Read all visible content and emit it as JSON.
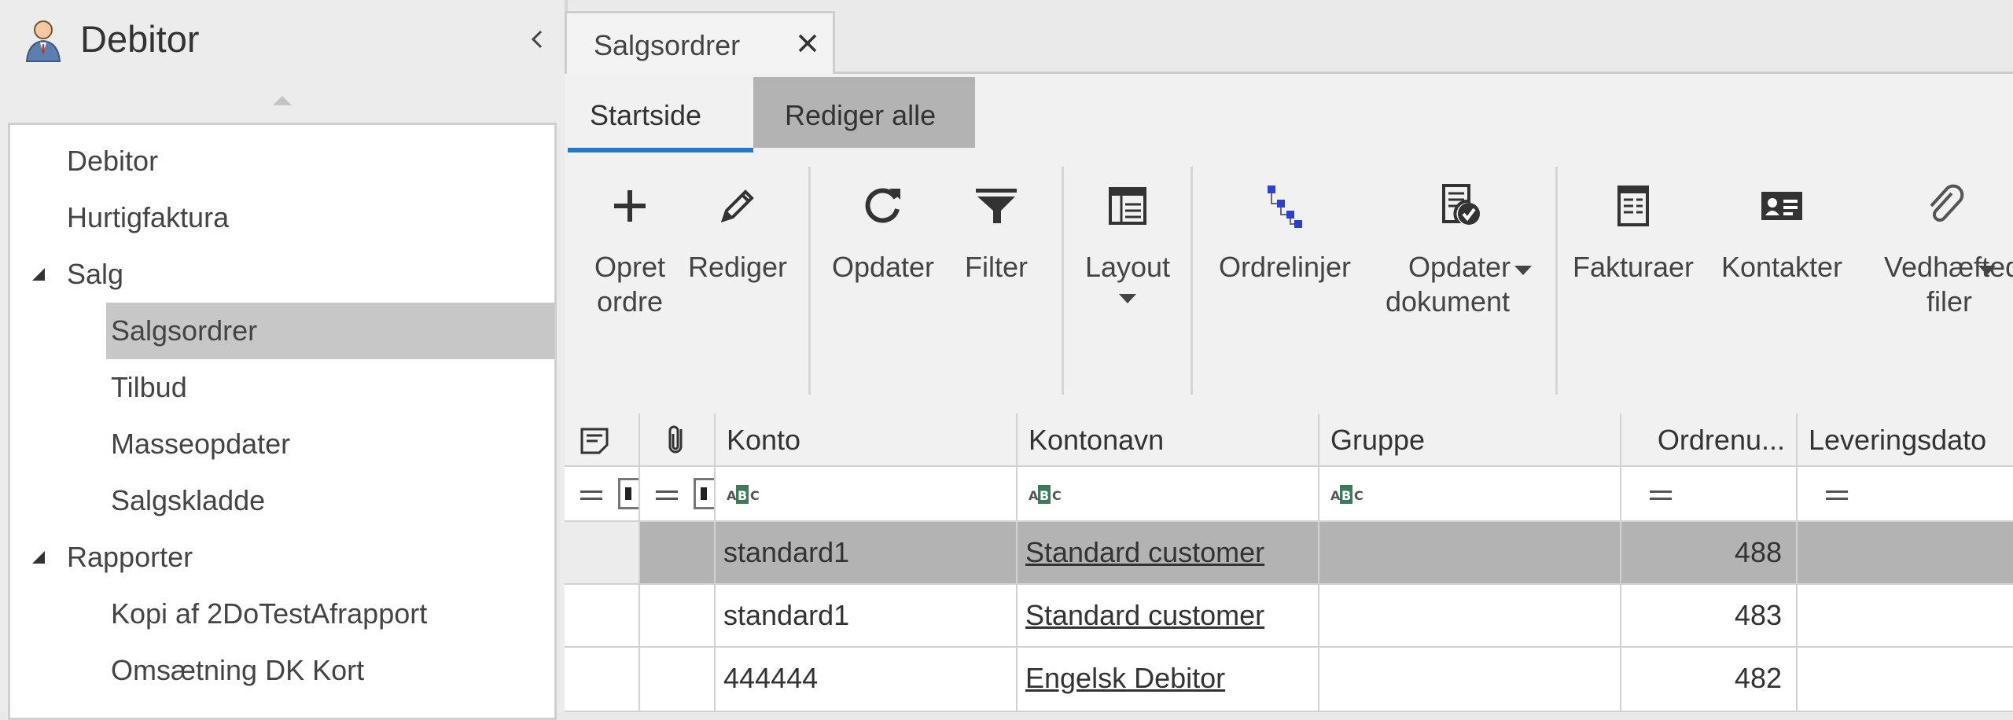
{
  "navigation": {
    "title": "Debitor",
    "items": [
      {
        "label": "Debitor",
        "level": 1,
        "expandable": false,
        "selected": false
      },
      {
        "label": "Hurtigfaktura",
        "level": 1,
        "expandable": false,
        "selected": false
      },
      {
        "label": "Salg",
        "level": 1,
        "expandable": true,
        "selected": false
      },
      {
        "label": "Salgsordrer",
        "level": 2,
        "expandable": false,
        "selected": true
      },
      {
        "label": "Tilbud",
        "level": 2,
        "expandable": false,
        "selected": false
      },
      {
        "label": "Masseopdater",
        "level": 2,
        "expandable": false,
        "selected": false
      },
      {
        "label": "Salgskladde",
        "level": 2,
        "expandable": false,
        "selected": false
      },
      {
        "label": "Rapporter",
        "level": 1,
        "expandable": true,
        "selected": false
      },
      {
        "label": "Kopi af 2DoTestAfrapport",
        "level": 2,
        "expandable": false,
        "selected": false
      },
      {
        "label": "Omsætning DK Kort",
        "level": 2,
        "expandable": false,
        "selected": false
      }
    ]
  },
  "document_tab": {
    "label": "Salgsordrer"
  },
  "ribbon": {
    "tabs": [
      {
        "label": "Startside",
        "active": true
      },
      {
        "label": "Rediger alle",
        "active": false
      }
    ],
    "buttons": [
      {
        "label_line1": "Opret",
        "label_line2": "ordre",
        "icon": "plus-icon"
      },
      {
        "label_line1": "Rediger",
        "label_line2": "",
        "icon": "pencil-icon"
      },
      {
        "label_line1": "Opdater",
        "label_line2": "",
        "icon": "refresh-icon"
      },
      {
        "label_line1": "Filter",
        "label_line2": "",
        "icon": "funnel-icon"
      },
      {
        "label_line1": "Layout",
        "label_line2": "",
        "icon": "layout-icon"
      },
      {
        "label_line1": "Ordrelinjer",
        "label_line2": "",
        "icon": "tree-icon"
      },
      {
        "label_line1": "Opdater",
        "label_line2": "dokument",
        "icon": "document-check-icon"
      },
      {
        "label_line1": "Fakturaer",
        "label_line2": "",
        "icon": "invoice-icon"
      },
      {
        "label_line1": "Kontakter",
        "label_line2": "",
        "icon": "contact-card-icon"
      },
      {
        "label_line1": "Vedhæfted",
        "label_line2": "filer",
        "icon": "paperclip-icon"
      }
    ]
  },
  "grid": {
    "columns": [
      "Konto",
      "Kontonavn",
      "Gruppe",
      "Ordrenu...",
      "Leveringsdato"
    ],
    "rows": [
      {
        "konto": "standard1",
        "kontonavn": "Standard customer",
        "gruppe": "",
        "ordrenummer": "488",
        "leveringsdato": "",
        "selected": true
      },
      {
        "konto": "standard1",
        "kontonavn": "Standard customer",
        "gruppe": "",
        "ordrenummer": "483",
        "leveringsdato": "",
        "selected": false
      },
      {
        "konto": "444444",
        "kontonavn": "Engelsk Debitor",
        "gruppe": "",
        "ordrenummer": "482",
        "leveringsdato": "",
        "selected": false
      }
    ]
  },
  "colors": {
    "accent": "#1f7bc7",
    "selected_row": "#b3b3b3",
    "tree_icon": "#2b3fd6"
  }
}
